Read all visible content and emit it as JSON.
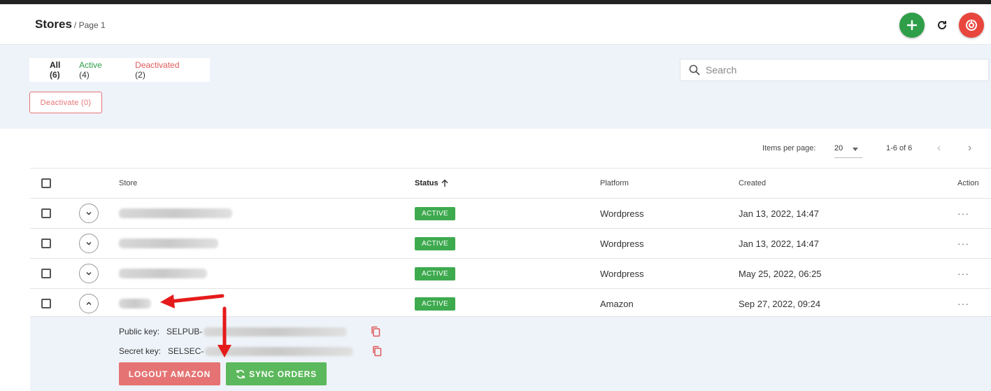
{
  "header": {
    "title": "Stores",
    "subtitle": "/ Page 1",
    "add_icon": "plus-icon",
    "refresh_icon": "refresh-icon",
    "power_icon": "power-icon",
    "accent": "#2e9e48",
    "danger": "#e8463d"
  },
  "filters": {
    "all_label": "All",
    "all_count": "(6)",
    "active_label": "Active",
    "active_count": "(4)",
    "deactivated_label": "Deactivated",
    "deactivated_count": "(2)"
  },
  "deactivate_button": "Deactivate (0)",
  "search": {
    "placeholder": "Search",
    "value": ""
  },
  "pagination": {
    "items_per_page_label": "Items per page:",
    "items_per_page": "20",
    "range": "1-6 of 6"
  },
  "table": {
    "columns": {
      "store": "Store",
      "status": "Status",
      "platform": "Platform",
      "created": "Created",
      "action": "Action"
    },
    "rows": [
      {
        "status": "ACTIVE",
        "platform": "Wordpress",
        "created": "Jan 13, 2022, 14:47",
        "action": "···"
      },
      {
        "status": "ACTIVE",
        "platform": "Wordpress",
        "created": "Jan 13, 2022, 14:47",
        "action": "···"
      },
      {
        "status": "ACTIVE",
        "platform": "Wordpress",
        "created": "May 25, 2022, 06:25",
        "action": "···"
      },
      {
        "status": "ACTIVE",
        "platform": "Amazon",
        "created": "Sep 27, 2022, 09:24",
        "action": "···"
      }
    ]
  },
  "detail": {
    "public_key_label": "Public key:",
    "public_key_prefix": "SELPUB-",
    "secret_key_label": "Secret key:",
    "secret_key_prefix": "SELSEC-",
    "logout_button": "LOGOUT AMAZON",
    "sync_button": "SYNC ORDERS"
  }
}
